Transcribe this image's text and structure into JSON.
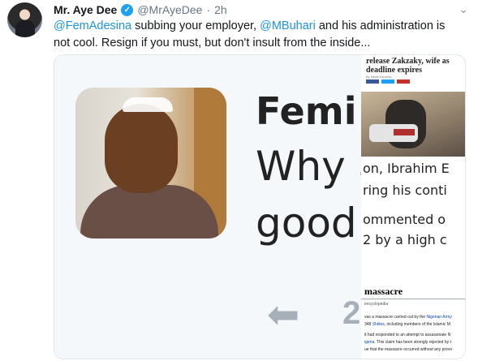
{
  "tweet": {
    "name": "Mr. Aye Dee",
    "verified_glyph": "✓",
    "handle": "@MrAyeDee",
    "separator": "·",
    "time": "2h",
    "chevron": "⌄",
    "text_parts": {
      "mention1": "@FemAdesina",
      "t1": " subbing your employer, ",
      "mention2": "@MBuhari",
      "t2": " and his administration is not cool. Resign if you must, but don't insult from the inside..."
    }
  },
  "media": {
    "left": {
      "line1": "Femi",
      "line2": "Why a",
      "line3": "good",
      "reply_icon": "⬅",
      "reply_count": "2"
    },
    "right": {
      "headline": "release Zakzaky, wife as deadline expires",
      "byline": "By News Express",
      "news_lines": [
        "on, Ibrahim E",
        "ring his conti",
        "ommented o",
        "2 by a high c"
      ],
      "wiki_title": "massacre",
      "wiki_sub": "encyclopedia",
      "wiki_lines": [
        {
          "pre": "vas a massacre carried out by the ",
          "link": "Nigerian Army",
          "post": ""
        },
        {
          "pre": "348 ",
          "link": "Shiites",
          "post": ", including members of the Islamic M"
        },
        {
          "pre": "it had responded to an attempt to assassinate N",
          "link": "",
          "post": ""
        },
        {
          "pre": "",
          "link": "igeria",
          "post": ". This claim has been strongly rejected by t"
        },
        {
          "pre": "ue that the massacre occurred without any provo",
          "link": "",
          "post": ""
        }
      ]
    }
  },
  "colors": {
    "mention": "#1b95e0",
    "verified": "#1da1f2",
    "secondary": "#657786"
  }
}
